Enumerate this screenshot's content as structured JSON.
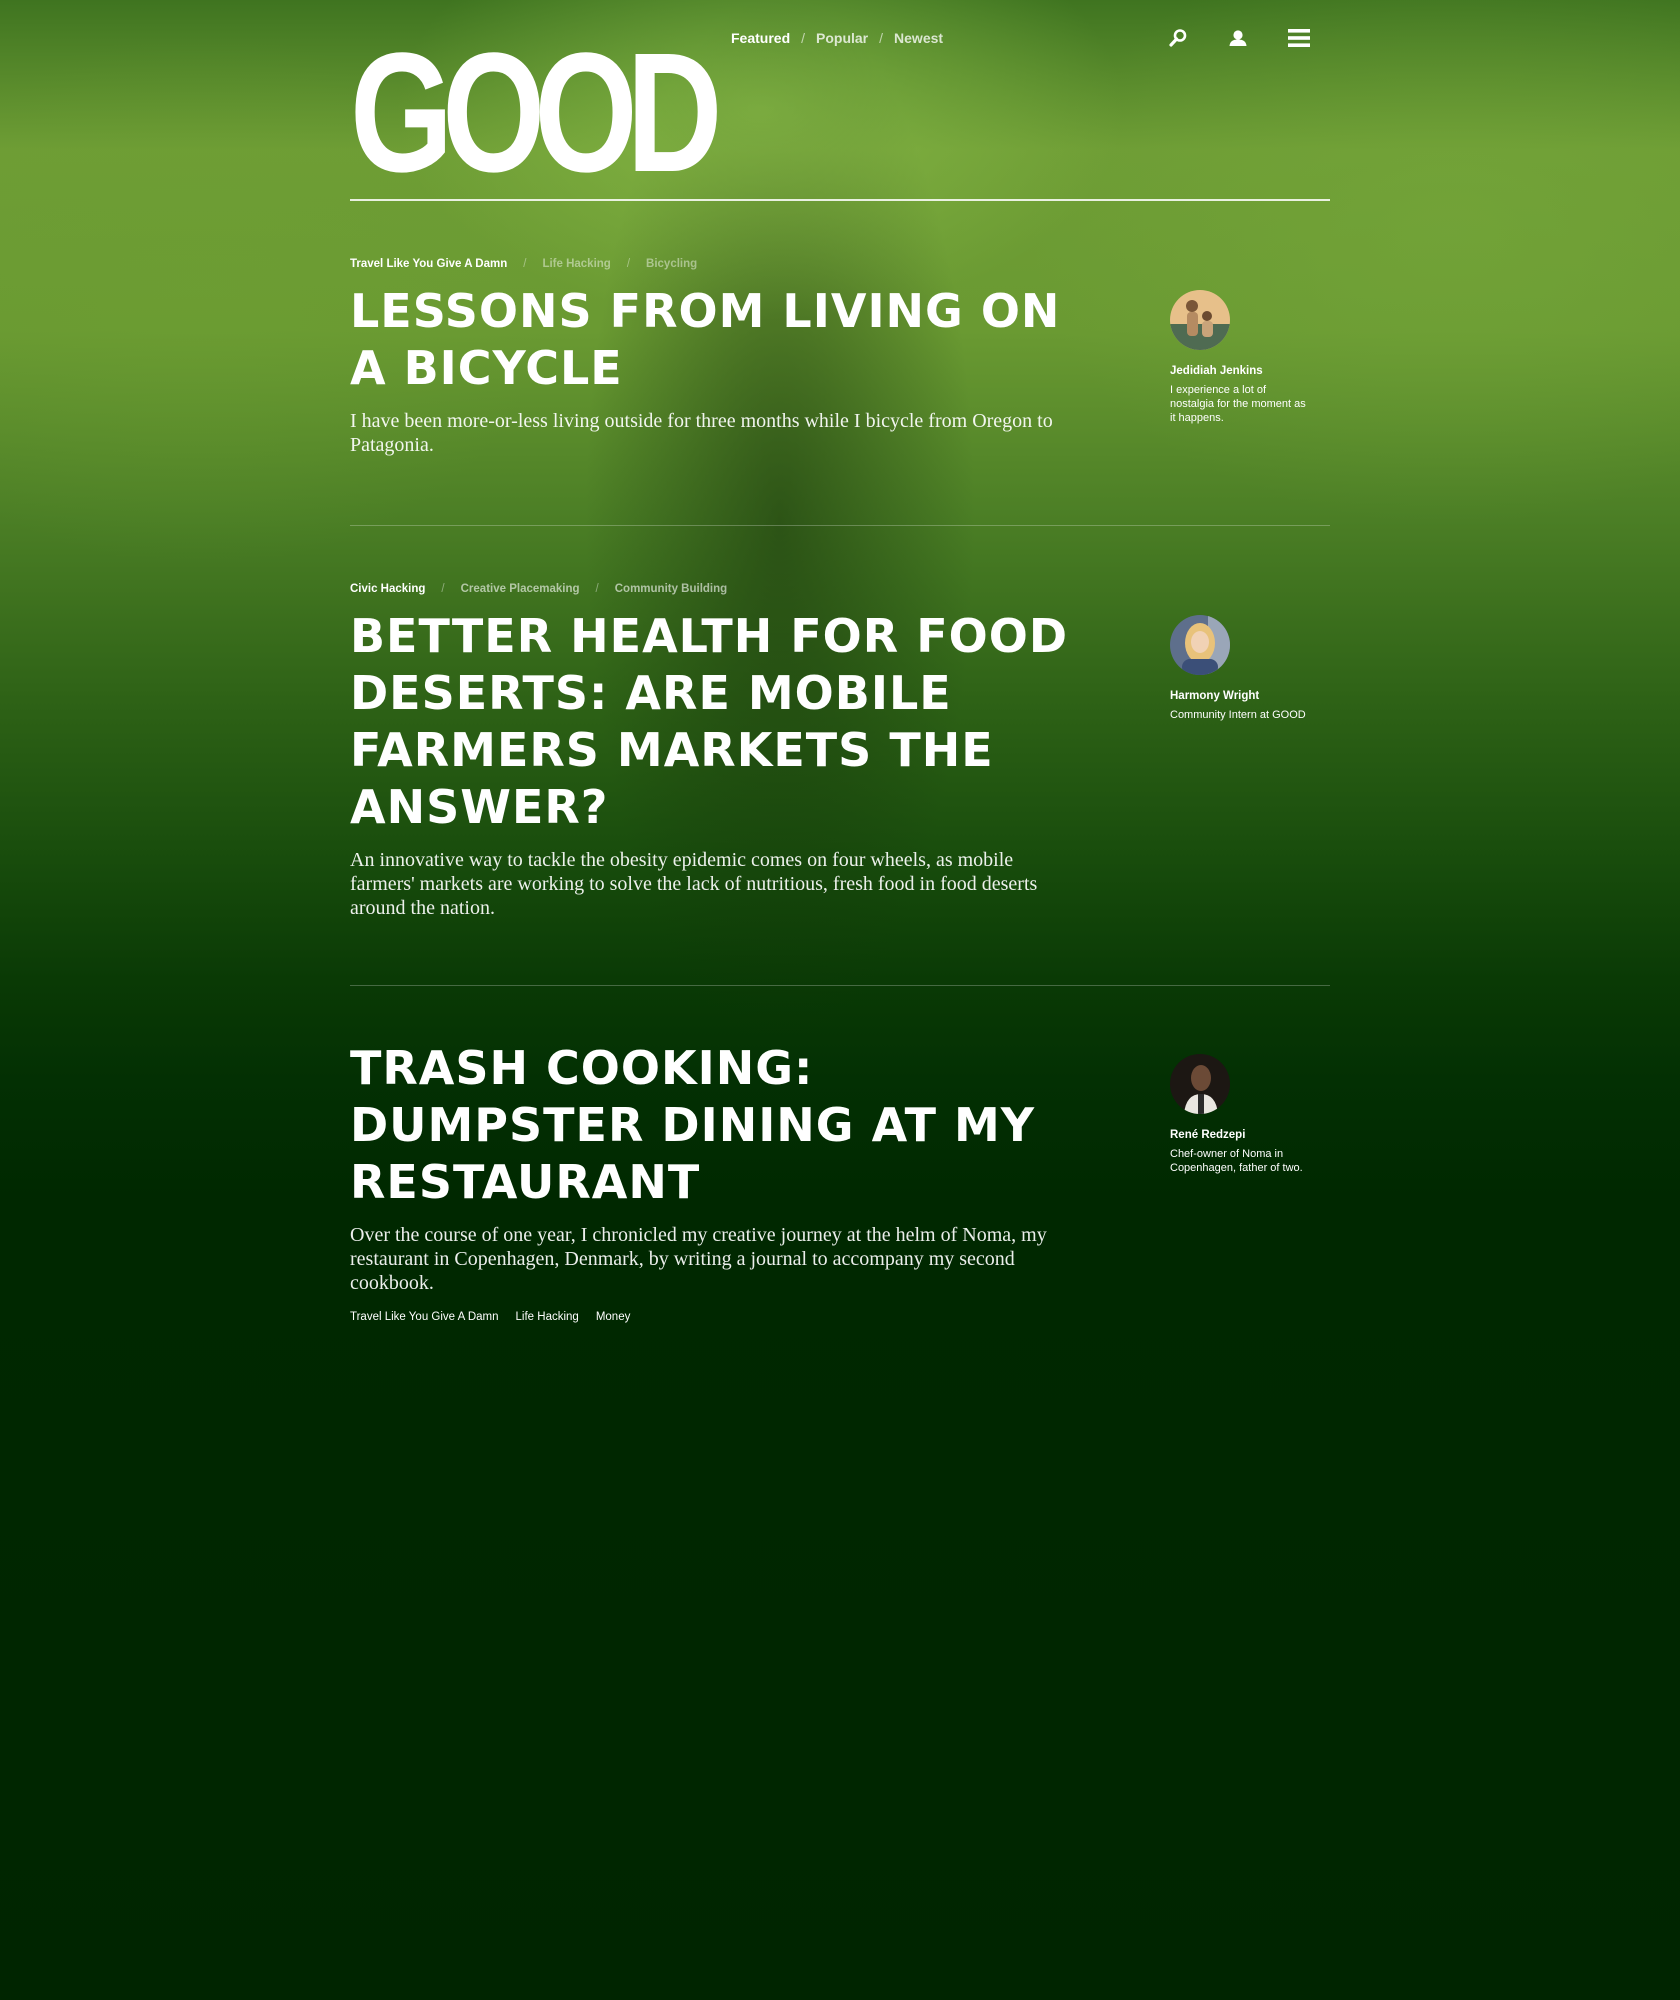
{
  "brand": {
    "logo": "GOOD"
  },
  "nav": {
    "items": [
      {
        "label": "Featured"
      },
      {
        "label": "Popular"
      },
      {
        "label": "Newest"
      }
    ],
    "separator": "/"
  },
  "icons": [
    "search-icon",
    "user-icon",
    "menu-icon"
  ],
  "articles": [
    {
      "tags": [
        "Travel Like You Give A Damn",
        "Life Hacking",
        "Bicycling"
      ],
      "title": "Lessons from Living on a Bicycle",
      "summary": "I have been more-or-less living outside for three months while I bicycle from Oregon to Patagonia.",
      "author": {
        "name": "Jedidiah Jenkins",
        "bio": "I experience a lot of nostalgia for the moment as it happens."
      }
    },
    {
      "tags": [
        "Civic Hacking",
        "Creative Placemaking",
        "Community Building"
      ],
      "title": "Better Health for Food Deserts: Are Mobile Farmers Markets the Answer?",
      "summary": "An innovative way to tackle the obesity epidemic comes on four wheels, as mobile farmers' markets are working to solve the lack of nutritious, fresh food in food deserts around the nation.",
      "author": {
        "name": "Harmony Wright",
        "bio": "Community Intern at GOOD"
      }
    },
    {
      "title": "Trash Cooking: Dumpster Dining at My Restaurant",
      "summary": "Over the course of one year, I chronicled my creative journey at the helm of Noma, my restaurant in Copenhagen, Denmark, by writing a journal to accompany my second cookbook.",
      "footer_tags": [
        "Travel Like You Give A Damn",
        "Life Hacking",
        "Money"
      ],
      "author": {
        "name": "René Redzepi",
        "bio": "Chef-owner of Noma in Copenhagen, father of two."
      }
    }
  ],
  "colors": {
    "background_top": "#6a9a32",
    "background_bottom": "#002500",
    "text": "#ffffff"
  }
}
